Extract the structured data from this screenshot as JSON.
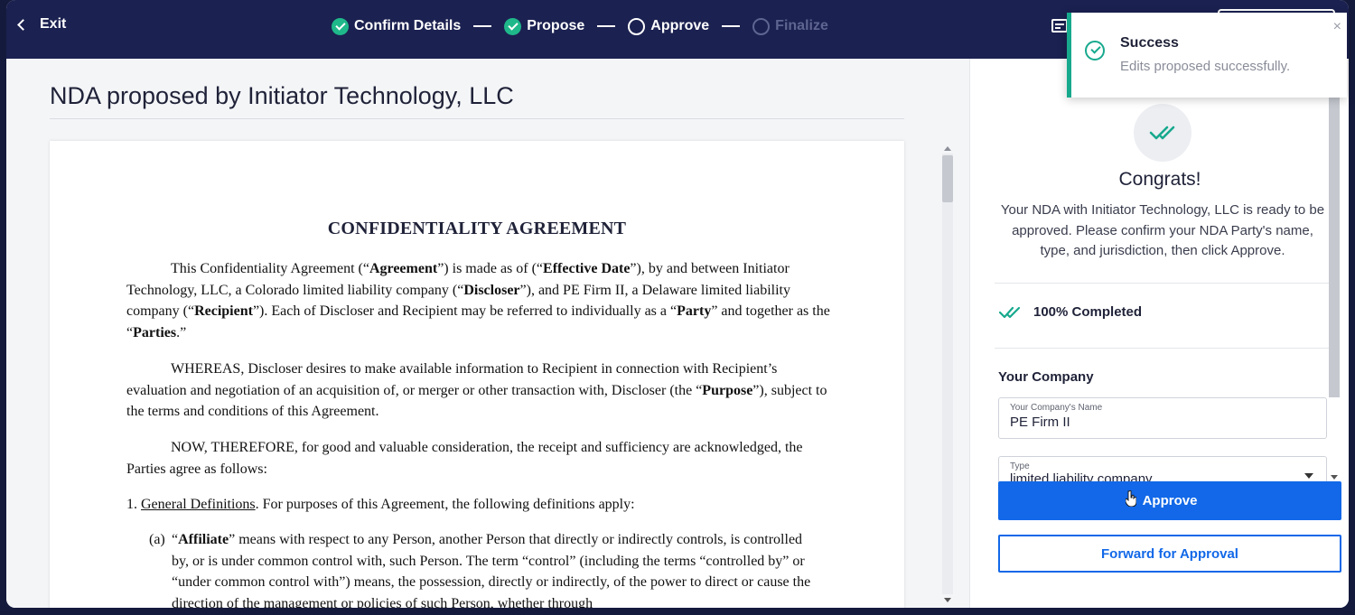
{
  "topbar": {
    "exit_label": "Exit",
    "steps": [
      {
        "label": "Confirm Details",
        "state": "done"
      },
      {
        "label": "Propose",
        "state": "done"
      },
      {
        "label": "Approve",
        "state": "current"
      },
      {
        "label": "Finalize",
        "state": "future"
      }
    ]
  },
  "document": {
    "title": "NDA proposed by Initiator Technology, LLC",
    "heading": "CONFIDENTIALITY AGREEMENT",
    "p1": {
      "a": "This Confidentiality Agreement (“",
      "b": "Agreement",
      "c": "”) is made as of (“",
      "d": "Effective Date",
      "e": "”), by and between Initiator Technology, LLC, a Colorado limited liability company (“",
      "f": "Discloser",
      "g": "”), and PE Firm II, a Delaware limited liability company (“",
      "h": "Recipient",
      "i": "”). Each of Discloser and Recipient may be referred to individually as a “",
      "j": "Party",
      "k": "” and together as the “",
      "l": "Parties",
      "m": ".”"
    },
    "p2": {
      "a": "WHEREAS, Discloser desires to make available information to Recipient in connection with Recipient’s evaluation and negotiation of an acquisition of, or merger or other transaction with, Discloser (the “",
      "b": "Purpose",
      "c": "”), subject to the terms and conditions of this Agreement."
    },
    "p3": "NOW, THEREFORE, for good and valuable consideration, the receipt and sufficiency are acknowledged, the Parties agree as follows:",
    "p4": {
      "num": "1.",
      "title": "General Definitions",
      "rest": ". For purposes of this Agreement, the following definitions apply:"
    },
    "p5": {
      "label": "(a)",
      "a": "“",
      "b": "Affiliate",
      "c": "” means with respect to any Person, another Person that directly or indirectly controls, is controlled by, or is under common control with, such Person. The term “control” (including the terms “controlled by” or “under common control with”) means, the possession, directly or indirectly, of the power to direct or cause the direction of the management or policies of such Person, whether through"
    }
  },
  "panel": {
    "congrats_title": "Congrats!",
    "congrats_text": "Your NDA with Initiator Technology, LLC is ready to be approved. Please confirm your NDA Party's name, type, and jurisdiction, then click Approve.",
    "progress_label": "100% Completed",
    "progress_value": 1.0,
    "section_title": "Your Company",
    "name_field": {
      "label": "Your Company's Name",
      "value": "PE Firm II"
    },
    "type_field": {
      "label": "Type",
      "value": "limited liability company"
    },
    "approve_label": "Approve",
    "forward_label": "Forward for Approval"
  },
  "toast": {
    "title": "Success",
    "message": "Edits proposed successfully.",
    "close": "×"
  },
  "colors": {
    "topbar": "#1b2150",
    "accent": "#1268e8",
    "success": "#17a98d"
  }
}
